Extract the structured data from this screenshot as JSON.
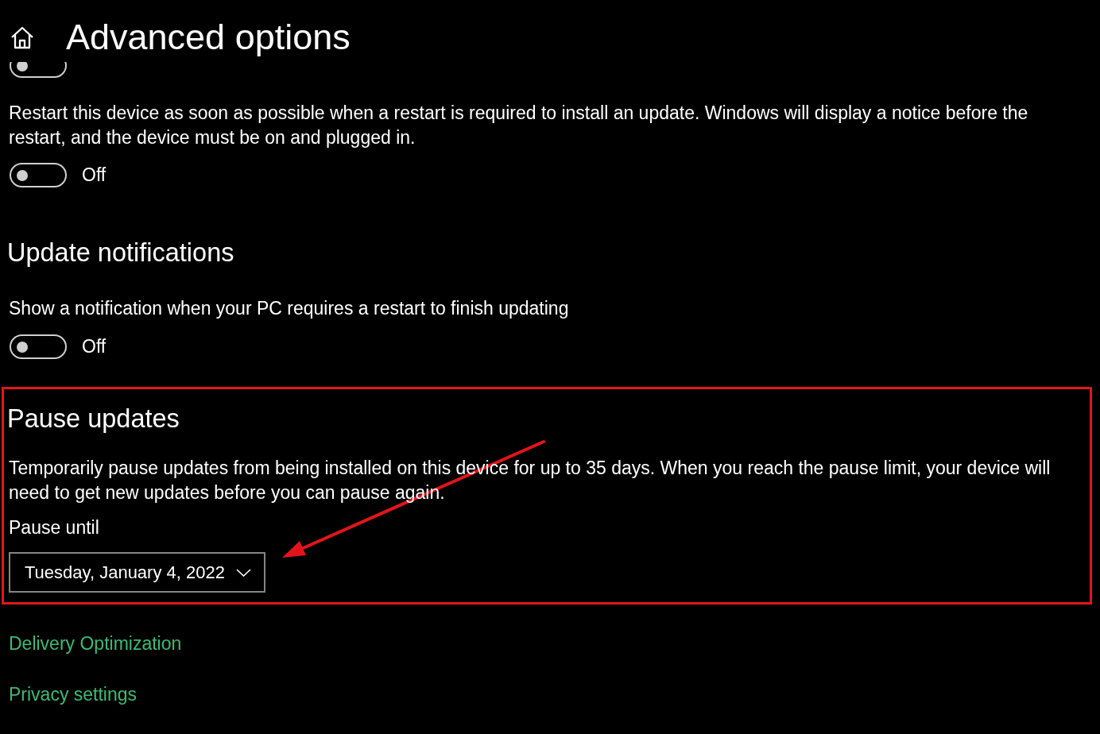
{
  "header": {
    "title": "Advanced options"
  },
  "partial_toggle": {
    "on": false
  },
  "restart_section": {
    "description": "Restart this device as soon as possible when a restart is required to install an update. Windows will display a notice before the restart, and the device must be on and plugged in.",
    "toggle": {
      "on": false,
      "label": "Off"
    }
  },
  "update_notifications": {
    "heading": "Update notifications",
    "description": "Show a notification when your PC requires a restart to finish updating",
    "toggle": {
      "on": false,
      "label": "Off"
    }
  },
  "pause_updates": {
    "highlighted": true,
    "heading": "Pause updates",
    "description": "Temporarily pause updates from being installed on this device for up to 35 days. When you reach the pause limit, your device will need to get new updates before you can pause again.",
    "pause_until": {
      "label": "Pause until",
      "value": "Tuesday, January 4, 2022"
    }
  },
  "links": [
    "Delivery Optimization",
    "Privacy settings"
  ]
}
